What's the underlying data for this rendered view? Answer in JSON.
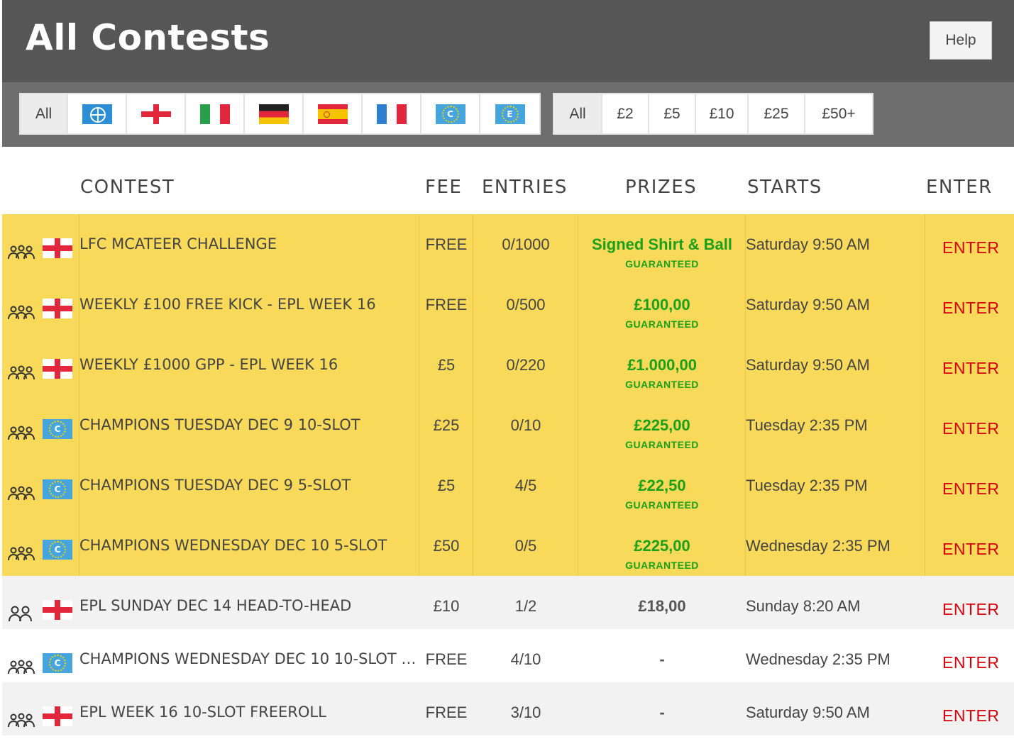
{
  "header": {
    "title": "All Contests",
    "help_label": "Help"
  },
  "filters": {
    "leagues": [
      {
        "label": "All",
        "icon": "",
        "active": true
      },
      {
        "label": "",
        "icon": "globe-icon"
      },
      {
        "label": "",
        "icon": "england-flag-icon"
      },
      {
        "label": "",
        "icon": "italy-flag-icon"
      },
      {
        "label": "",
        "icon": "germany-flag-icon"
      },
      {
        "label": "",
        "icon": "spain-flag-icon"
      },
      {
        "label": "",
        "icon": "france-flag-icon"
      },
      {
        "label": "",
        "icon": "champions-league-icon"
      },
      {
        "label": "",
        "icon": "europa-league-icon"
      }
    ],
    "fees": [
      {
        "label": "All",
        "active": true
      },
      {
        "label": "£2"
      },
      {
        "label": "£5"
      },
      {
        "label": "£10"
      },
      {
        "label": "£25"
      },
      {
        "label": "£50+"
      }
    ],
    "champions_letter": "C",
    "europa_letter": "E"
  },
  "table": {
    "columns": {
      "contest": "CONTEST",
      "fee": "FEE",
      "entries": "ENTRIES",
      "prizes": "PRIZES",
      "starts": "STARTS",
      "enter": "ENTER"
    },
    "rows": [
      {
        "type": "multi",
        "flag": "england",
        "name": "LFC MCATEER CHALLENGE",
        "fee": "FREE",
        "entries": "0/1000",
        "prize": "Signed Shirt & Ball",
        "prize_note": "GUARANTEED",
        "starts": "Saturday 9:50 AM",
        "enter": "ENTER",
        "featured": true
      },
      {
        "type": "multi",
        "flag": "england",
        "name": "WEEKLY £100 FREE KICK - EPL WEEK 16",
        "fee": "FREE",
        "entries": "0/500",
        "prize": "£100,00",
        "prize_note": "GUARANTEED",
        "starts": "Saturday 9:50 AM",
        "enter": "ENTER",
        "featured": true
      },
      {
        "type": "multi",
        "flag": "england",
        "name": "WEEKLY £1000 GPP - EPL WEEK 16",
        "fee": "£5",
        "entries": "0/220",
        "prize": "£1.000,00",
        "prize_note": "GUARANTEED",
        "starts": "Saturday 9:50 AM",
        "enter": "ENTER",
        "featured": true
      },
      {
        "type": "multi",
        "flag": "champions",
        "name": "CHAMPIONS TUESDAY DEC 9 10-SLOT",
        "fee": "£25",
        "entries": "0/10",
        "prize": "£225,00",
        "prize_note": "GUARANTEED",
        "starts": "Tuesday 2:35 PM",
        "enter": "ENTER",
        "featured": true
      },
      {
        "type": "multi",
        "flag": "champions",
        "name": "CHAMPIONS TUESDAY DEC 9 5-SLOT",
        "fee": "£5",
        "entries": "4/5",
        "prize": "£22,50",
        "prize_note": "GUARANTEED",
        "starts": "Tuesday 2:35 PM",
        "enter": "ENTER",
        "featured": true
      },
      {
        "type": "multi",
        "flag": "champions",
        "name": "CHAMPIONS WEDNESDAY DEC 10 5-SLOT",
        "fee": "£50",
        "entries": "0/5",
        "prize": "£225,00",
        "prize_note": "GUARANTEED",
        "starts": "Wednesday 2:35 PM",
        "enter": "ENTER",
        "featured": true
      },
      {
        "type": "h2h",
        "flag": "england",
        "name": "EPL SUNDAY DEC 14 HEAD-TO-HEAD",
        "fee": "£10",
        "entries": "1/2",
        "prize": "£18,00",
        "prize_note": "",
        "starts": "Sunday 8:20 AM",
        "enter": "ENTER",
        "featured": false
      },
      {
        "type": "multi",
        "flag": "champions",
        "name": "CHAMPIONS WEDNESDAY DEC 10 10-SLOT …",
        "fee": "FREE",
        "entries": "4/10",
        "prize": "-",
        "prize_note": "",
        "starts": "Wednesday 2:35 PM",
        "enter": "ENTER",
        "featured": false
      },
      {
        "type": "multi",
        "flag": "england",
        "name": "EPL WEEK 16 10-SLOT FREEROLL",
        "fee": "FREE",
        "entries": "3/10",
        "prize": "-",
        "prize_note": "",
        "starts": "Saturday 9:50 AM",
        "enter": "ENTER",
        "featured": false
      }
    ]
  },
  "colors": {
    "header_bg": "#565656",
    "filterbar_bg": "#6e6e6e",
    "featured_row": "#f8d959",
    "prize_green": "#1aa01a",
    "enter_red": "#d4000d"
  }
}
